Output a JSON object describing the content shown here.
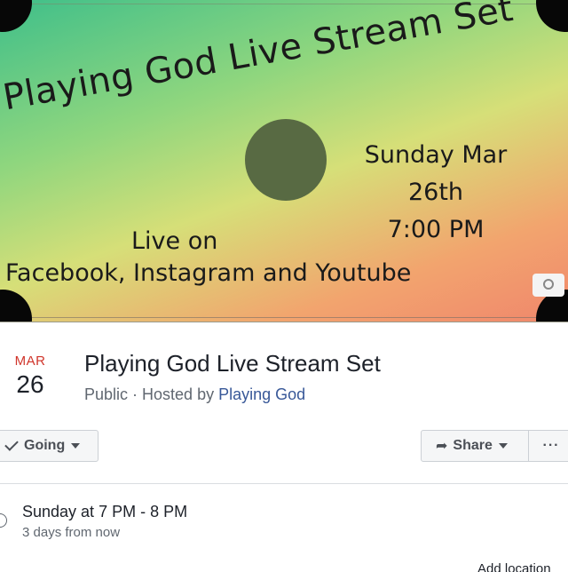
{
  "cover": {
    "title": "Playing God Live Stream Set",
    "date_line": "Sunday Mar 26th",
    "time_line": "7:00 PM",
    "live_line1": "Live on",
    "live_line2": "Facebook, Instagram and Youtube",
    "icon": "camera-icon"
  },
  "event": {
    "month": "MAR",
    "day": "26",
    "title": "Playing God Live Stream Set",
    "visibility": "Public",
    "separator": " · ",
    "hosted_prefix": "Hosted by ",
    "host": "Playing God"
  },
  "actions": {
    "going_label": "Going",
    "share_label": "Share",
    "more_label": "···"
  },
  "details": {
    "time": "Sunday at 7 PM - 8 PM",
    "relative": "3 days from now",
    "cutoff_text": "Add location"
  },
  "colors": {
    "month_red": "#d0352b",
    "host_link": "#385898",
    "text_primary": "#1d2129",
    "text_secondary": "#606770"
  }
}
